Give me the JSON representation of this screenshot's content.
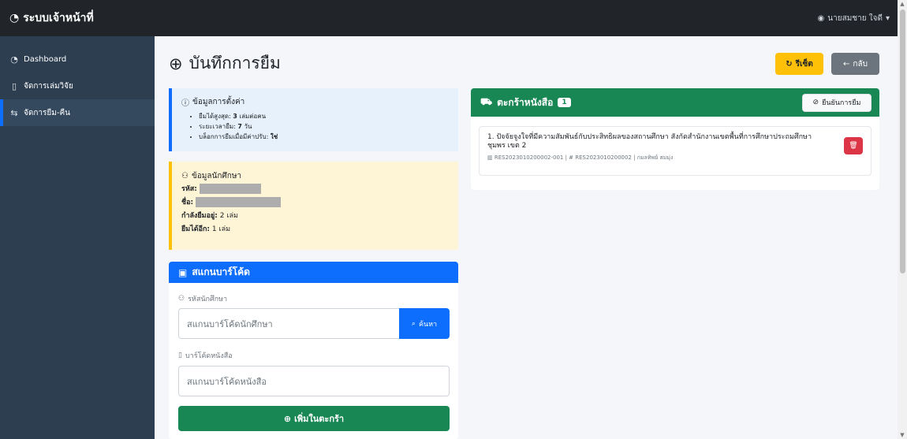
{
  "navbar": {
    "brand": "ระบบเจ้าหน้าที่",
    "user": "นายสมชาย ใจดี"
  },
  "sidebar": {
    "items": [
      {
        "label": "Dashboard",
        "icon": "speedometer-icon"
      },
      {
        "label": "จัดการเล่มวิจัย",
        "icon": "book-icon"
      },
      {
        "label": "จัดการยืม-คืน",
        "icon": "swap-icon",
        "active": true
      }
    ]
  },
  "page": {
    "title": "บันทึกการยืม",
    "reset_label": "รีเซ็ต",
    "back_label": "กลับ"
  },
  "settings": {
    "title": "ข้อมูลการตั้งค่า",
    "max_label": "ยืมได้สูงสุด:",
    "max_value": "3",
    "max_unit": "เล่มต่อคน",
    "period_label": "ระยะเวลายืม:",
    "period_value": "7",
    "period_unit": "วัน",
    "block_label": "บล็อกการยืมเมื่อมีค่าปรับ:",
    "block_value": "ใช่"
  },
  "student": {
    "title": "ข้อมูลนักศึกษา",
    "id_label": "รหัส:",
    "name_label": "ชื่อ:",
    "borrowing_label": "กำลังยืมอยู่:",
    "borrowing_value": "2 เล่ม",
    "remaining_label": "ยืมได้อีก:",
    "remaining_value": "1 เล่ม"
  },
  "scan": {
    "title": "สแกนบาร์โค้ด",
    "student_label": "รหัสนักศึกษา",
    "student_placeholder": "สแกนบาร์โค้ดนักศึกษา",
    "search_label": "ค้นหา",
    "book_label": "บาร์โค้ดหนังสือ",
    "book_placeholder": "สแกนบาร์โค้ดหนังสือ",
    "add_label": "เพิ่มในตะกร้า"
  },
  "cart": {
    "title": "ตะกร้าหนังสือ",
    "count": "1",
    "confirm_label": "ยืนยันการยืม",
    "items": [
      {
        "title": "1. ปัจจัยจูงใจที่มีความสัมพันธ์กับประสิทธิผลของสถานศึกษา สังกัดสำนักงานเขตพื้นที่การศึกษาประถมศึกษาชุมพร เขต 2",
        "meta": "RES2023010200002-001 | # RES2023010200002 | กมลทิพย์ สมมุ่ง"
      }
    ]
  },
  "colors": {
    "primary": "#0d6efd",
    "success": "#198754",
    "warning": "#ffc107",
    "danger": "#dc3545",
    "sidebar": "#2c3e50",
    "navbar": "#212529"
  }
}
